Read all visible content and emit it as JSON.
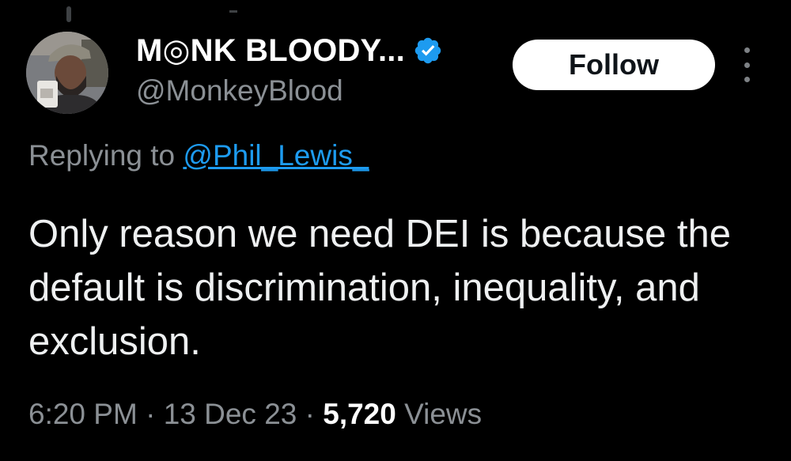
{
  "user": {
    "display_name": "M◎NK BLOODY...",
    "handle": "@MonkeyBlood",
    "verified_icon": "verified-badge-icon"
  },
  "actions": {
    "follow_label": "Follow",
    "more_icon": "more-options-icon"
  },
  "reply": {
    "prefix": "Replying to ",
    "target": "@Phil_Lewis_"
  },
  "tweet": {
    "text": "Only reason we need DEI is because the default is discrimination, inequality, and exclusion."
  },
  "meta": {
    "time": "6:20 PM",
    "separator": " · ",
    "date": "13 Dec 23",
    "views_count": "5,720",
    "views_label": " Views"
  },
  "colors": {
    "background": "#000000",
    "link": "#1d9bf0",
    "secondary_text": "#8b9095",
    "verified": "#1d9bf0"
  }
}
